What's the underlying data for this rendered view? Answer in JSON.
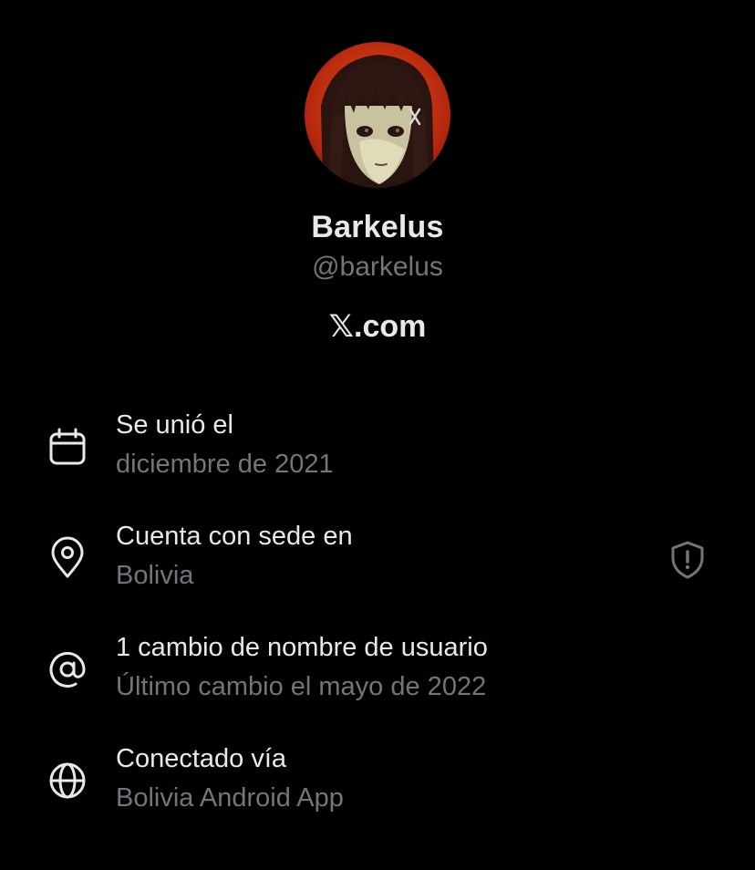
{
  "profile": {
    "display_name": "Barkelus",
    "handle": "@barkelus",
    "brand": "𝕏.com",
    "avatar_icon": "avatar-image"
  },
  "about": {
    "joined": {
      "icon": "calendar-icon",
      "title": "Se unió el",
      "value": "diciembre de 2021"
    },
    "location": {
      "icon": "location-pin-icon",
      "title": "Cuenta con sede en",
      "value": "Bolivia",
      "badge_icon": "shield-alert-icon"
    },
    "username_changes": {
      "icon": "at-sign-icon",
      "title": "1 cambio de nombre de usuario",
      "value": "Último cambio el mayo de 2022"
    },
    "connected_via": {
      "icon": "globe-icon",
      "title": "Conectado vía",
      "value": "Bolivia Android App"
    }
  },
  "colors": {
    "background": "#000000",
    "primary_text": "#e7e9ea",
    "secondary_text": "#71767b"
  }
}
